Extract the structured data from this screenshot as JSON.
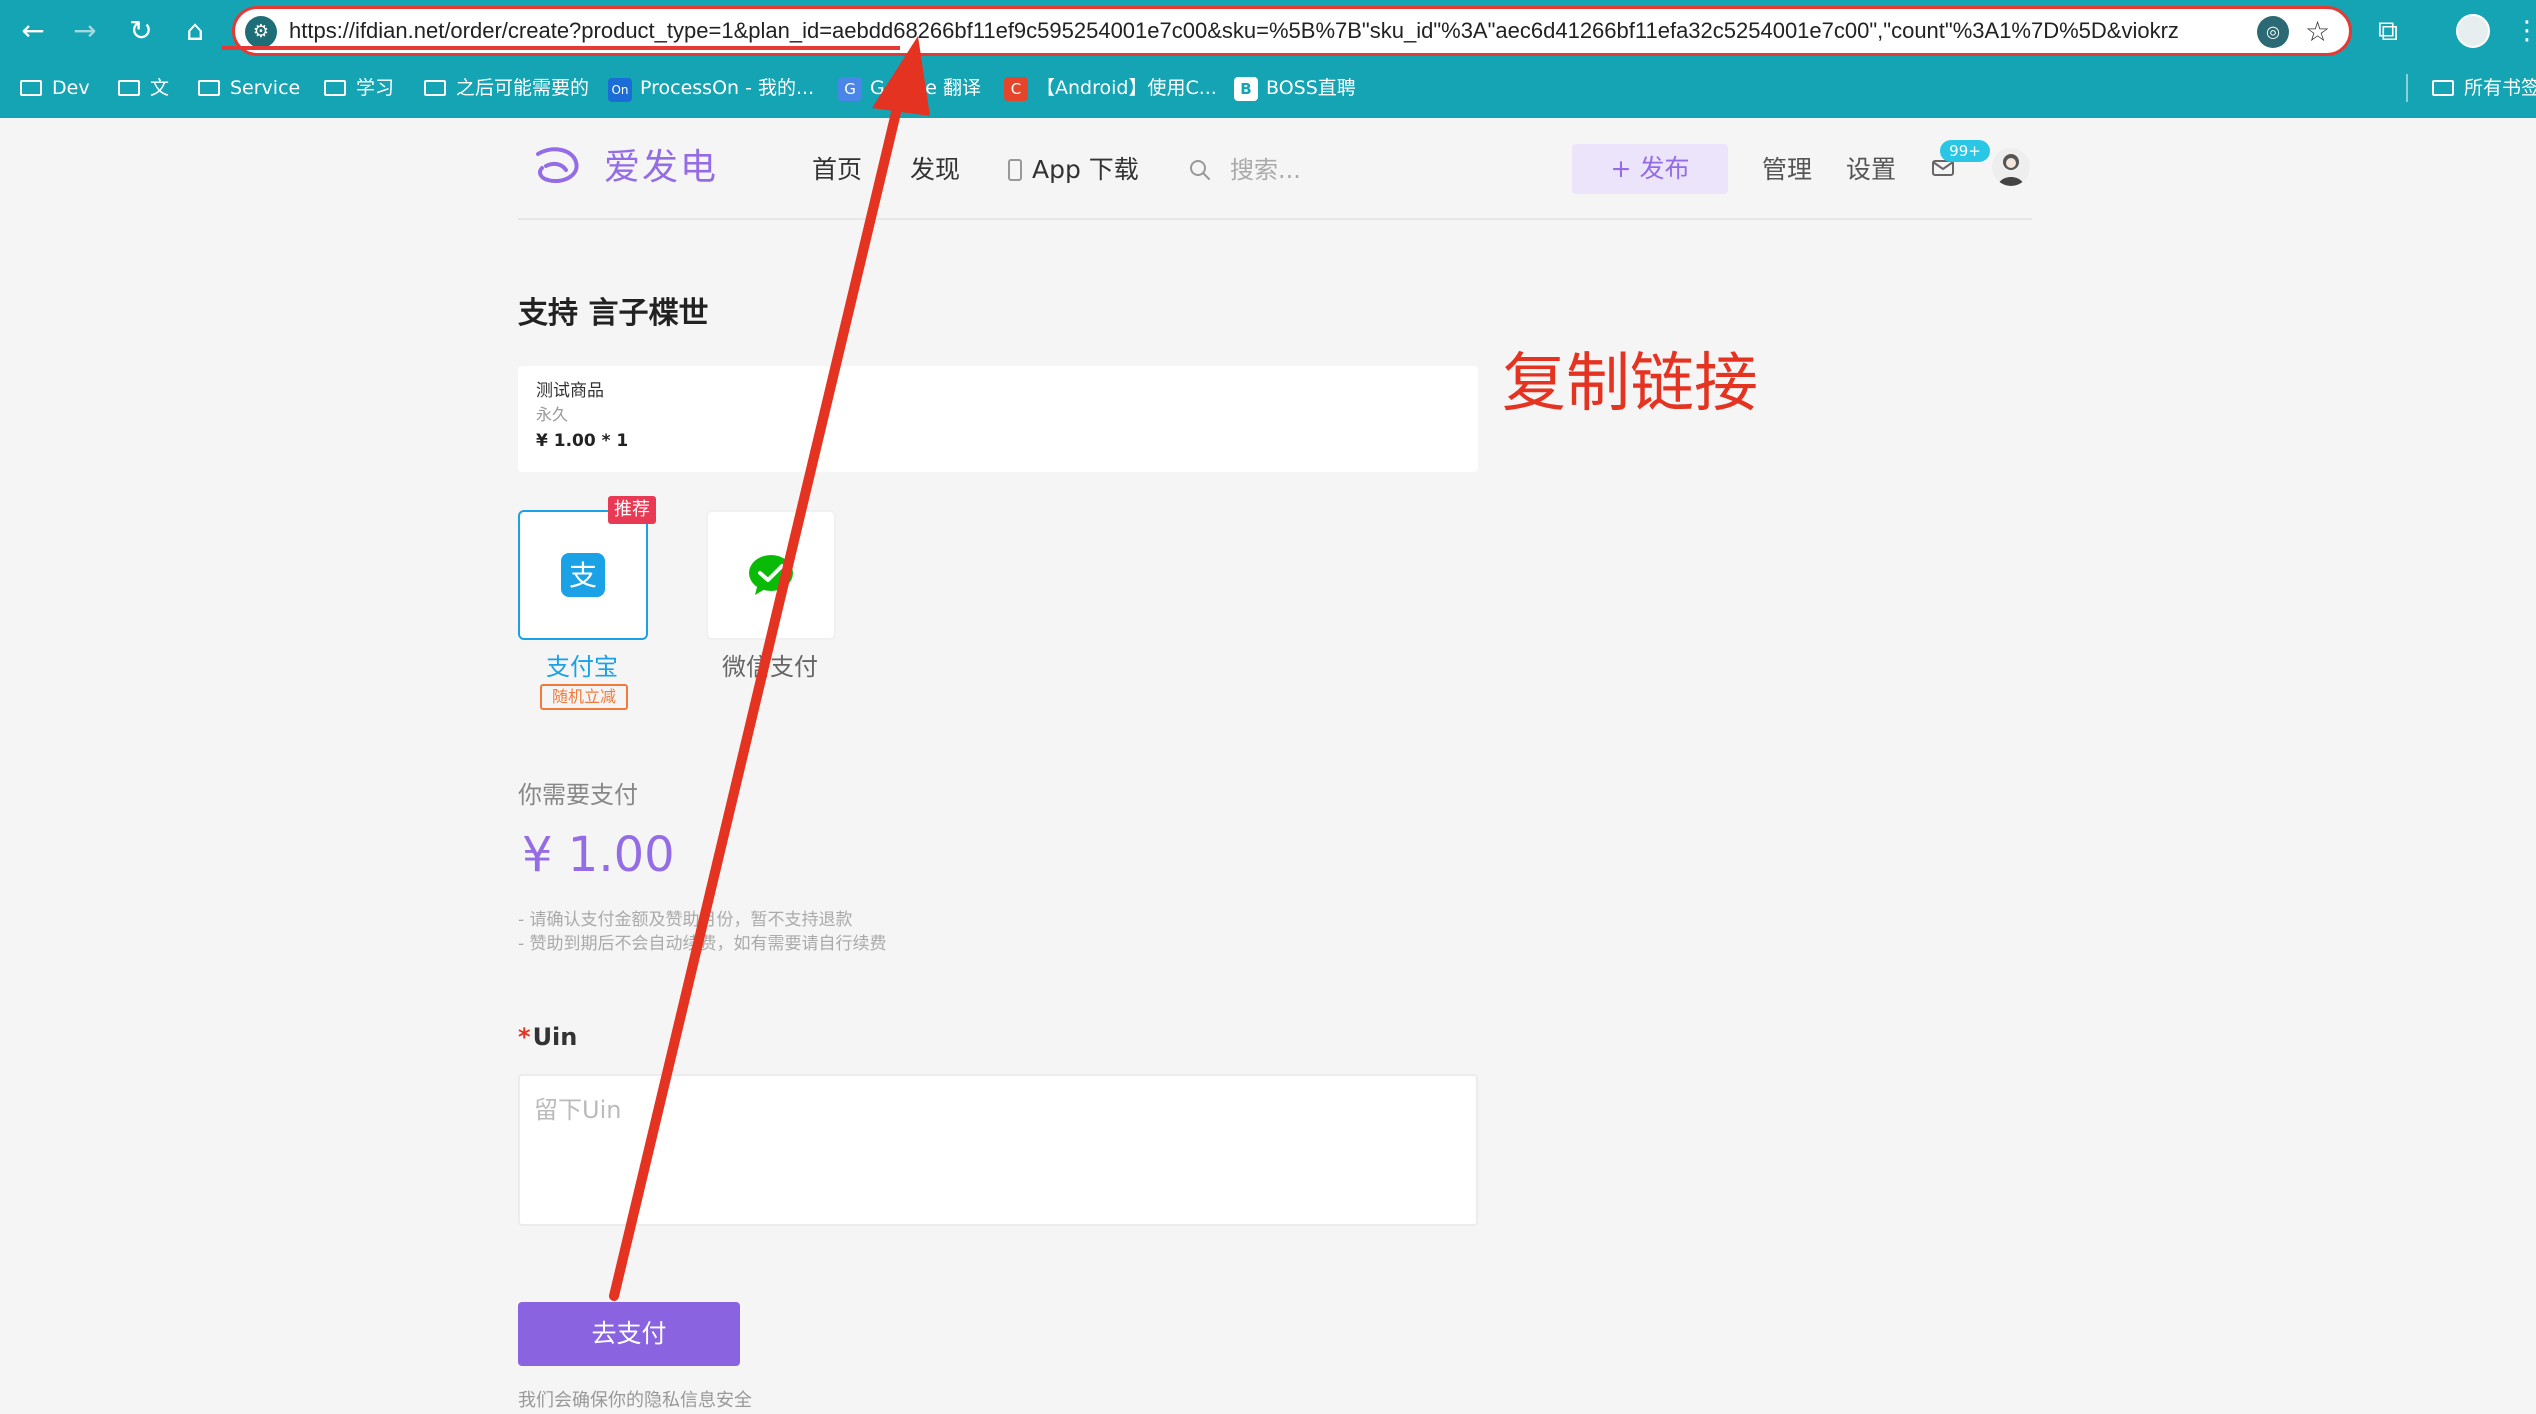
{
  "browser": {
    "url": "https://ifdian.net/order/create?product_type=1&plan_id=aebdd68266bf11ef9c595254001e7c00&sku=%5B%7B\"sku_id\"%3A\"aec6d41266bf11efa32c5254001e7c00\",\"count\"%3A1%7D%5D&viokrz",
    "bookmarks": [
      "Dev",
      "文",
      "Service",
      "学习",
      "之后可能需要的",
      "ProcessOn - 我的...",
      "Google 翻译",
      "【Android】使用C...",
      "BOSS直聘"
    ],
    "bookmark_right": "所有书签"
  },
  "site": {
    "logo_text": "爱发电",
    "nav": [
      "首页",
      "发现",
      "App 下载"
    ],
    "search_placeholder": "搜索...",
    "publish_label": "+ 发布",
    "manage_label": "管理",
    "settings_label": "设置",
    "mail_badge": "99+"
  },
  "order": {
    "title": "支持 言子楪世",
    "product_name": "测试商品",
    "product_term": "永久",
    "product_price": "¥ 1.00 * 1"
  },
  "annotation": {
    "text": "复制链接",
    "color": "#e53322"
  },
  "payment": {
    "recommend_badge": "推荐",
    "methods": [
      {
        "name": "支付宝",
        "promo": "随机立减",
        "selected": true,
        "icon": "alipay-icon",
        "color": "#1aa1e6"
      },
      {
        "name": "微信支付",
        "promo": "",
        "selected": false,
        "icon": "wechat-pay-icon",
        "color": "#09bb07"
      }
    ],
    "need_pay_label": "你需要支付",
    "amount": "¥ 1.00",
    "notes": [
      "- 请确认支付金额及赞助月份，暂不支持退款",
      "- 赞助到期后不会自动续费，如有需要请自行续费"
    ]
  },
  "form": {
    "uin_label": "Uin",
    "uin_required_mark": "*",
    "uin_placeholder": "留下Uin",
    "uin_value": "",
    "submit_label": "去支付",
    "privacy_text": "我们会确保你的隐私信息安全"
  },
  "colors": {
    "brand": "#946ce6",
    "chrome": "#14a4b4",
    "button": "#8a63e0"
  }
}
